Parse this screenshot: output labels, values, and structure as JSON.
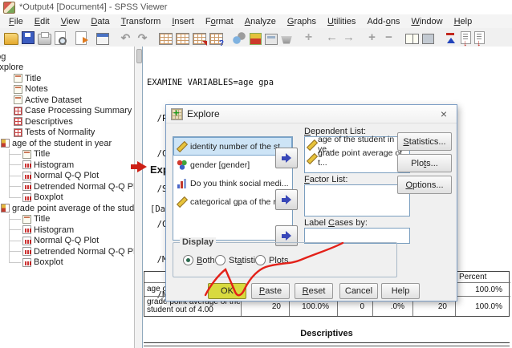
{
  "window": {
    "title": "*Output4 [Document4] - SPSS Viewer"
  },
  "menu": {
    "items": [
      "File",
      "Edit",
      "View",
      "Data",
      "Transform",
      "Insert",
      "Format",
      "Analyze",
      "Graphs",
      "Utilities",
      "Add-ons",
      "Window",
      "Help"
    ]
  },
  "toolbar": {
    "icons": [
      "open",
      "save",
      "print",
      "print-preview",
      "export",
      "recall-dialogs",
      "undo",
      "redo",
      "goto-data",
      "goto-case",
      "insert-variables",
      "use-sets",
      "charts",
      "run-script",
      "output-window",
      "basket",
      "insert",
      "previous-output",
      "next-output",
      "promote",
      "demote",
      "show",
      "hide",
      "sort",
      "insert-heading",
      "insert-text"
    ]
  },
  "outline": {
    "items": [
      {
        "label": "Log",
        "icon": "doc"
      },
      {
        "label": "Explore",
        "icon": "doc"
      },
      {
        "label": "Title",
        "icon": "doc"
      },
      {
        "label": "Notes",
        "icon": "doc"
      },
      {
        "label": "Active Dataset",
        "icon": "doc"
      },
      {
        "label": "Case Processing Summary",
        "icon": "table"
      },
      {
        "label": "Descriptives",
        "icon": "table"
      },
      {
        "label": "Tests of Normality",
        "icon": "table"
      },
      {
        "label": "age of the student in year",
        "icon": "section"
      },
      {
        "label": "Title",
        "icon": "doc"
      },
      {
        "label": "Histogram",
        "icon": "chart"
      },
      {
        "label": "Normal Q-Q Plot",
        "icon": "chart"
      },
      {
        "label": "Detrended Normal Q-Q Plot",
        "icon": "chart"
      },
      {
        "label": "Boxplot",
        "icon": "chart"
      },
      {
        "label": "grade point average of the student",
        "icon": "section"
      },
      {
        "label": "Title",
        "icon": "doc"
      },
      {
        "label": "Histogram",
        "icon": "chart"
      },
      {
        "label": "Normal Q-Q Plot",
        "icon": "chart"
      },
      {
        "label": "Detrended Normal Q-Q Plot",
        "icon": "chart"
      },
      {
        "label": "Boxplot",
        "icon": "chart"
      }
    ]
  },
  "output": {
    "syntax_lines": [
      "EXAMINE VARIABLES=age gpa",
      "  /PLOT BOXPLOT HISTOGRAM NPPLOT",
      "  /COMPARE GROUP",
      "  /STATISTICS DESCRIPTIVES",
      "  /CI",
      "  /MI",
      "  /NO"
    ],
    "explore_heading": "Expl",
    "dataset_line": "[Data",
    "case_table": {
      "visible_header": "Percent",
      "rows": [
        {
          "label": "age o",
          "values": [
            "",
            "",
            "",
            "",
            "",
            "100.0%"
          ]
        },
        {
          "label": "grade point average of the student out of 4.00",
          "values": [
            "20",
            "100.0%",
            "0",
            ".0%",
            "20",
            "100.0%"
          ]
        }
      ]
    },
    "descriptives_heading": "Descriptives"
  },
  "dialog": {
    "title": "Explore",
    "close_glyph": "×",
    "source_list": [
      {
        "label": "identity number of the st...",
        "icon": "scale-icon",
        "selected": true
      },
      {
        "label": "gender  [gender]",
        "icon": "nominal-icon",
        "selected": false
      },
      {
        "label": "Do you think social medi...",
        "icon": "ordinal-icon",
        "selected": false
      },
      {
        "label": "categorical gpa of the r...",
        "icon": "scale-icon",
        "selected": false
      }
    ],
    "dependent": {
      "label": "Dependent List:",
      "items": [
        {
          "label": "age of the student in ye...",
          "icon": "scale-icon"
        },
        {
          "label": "grade point average of t...",
          "icon": "scale-icon"
        }
      ]
    },
    "factor": {
      "label": "Factor List:"
    },
    "label_cases": {
      "label": "Label Cases by:",
      "value": ""
    },
    "side_buttons": [
      {
        "label": "Statistics..."
      },
      {
        "label": "Plots..."
      },
      {
        "label": "Options..."
      }
    ],
    "display": {
      "label": "Display",
      "options": [
        {
          "label": "Both",
          "selected": true
        },
        {
          "label": "Statistics",
          "selected": false
        },
        {
          "label": "Plots",
          "selected": false
        }
      ]
    },
    "buttons": [
      {
        "label": "OK",
        "highlighted": true
      },
      {
        "label": "Paste",
        "highlighted": false
      },
      {
        "label": "Reset",
        "highlighted": false
      },
      {
        "label": "Cancel",
        "highlighted": false
      },
      {
        "label": "Help",
        "highlighted": false
      }
    ]
  },
  "annotations": {
    "arrow_color": "#cc2016",
    "scribble_color": "#e32119",
    "ok_highlight_color": "#d8da3f"
  },
  "colors": {
    "selection_bg": "#cde4f6",
    "pane_border": "#4c7da0"
  }
}
